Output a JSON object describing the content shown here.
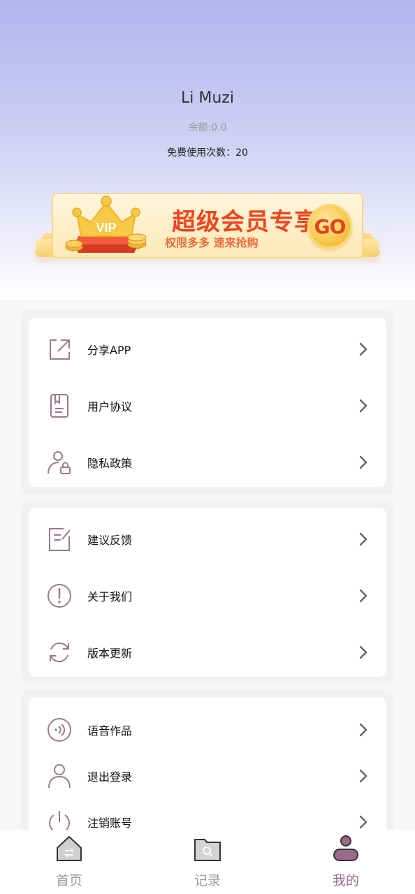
{
  "profile": {
    "username": "Li Muzi",
    "balance_text": "余额:0.0",
    "free_uses_text": "免费使用次数：20"
  },
  "vip_banner": {
    "crown_text": "VIP",
    "title": "超级会员专享",
    "subtitle": "权限多多 速来抢购",
    "go_label": "GO"
  },
  "menu_groups": [
    {
      "items": [
        {
          "label": "分享APP",
          "icon": "share-icon"
        },
        {
          "label": "用户协议",
          "icon": "document-bookmark-icon"
        },
        {
          "label": "隐私政策",
          "icon": "user-lock-icon"
        }
      ]
    },
    {
      "items": [
        {
          "label": "建议反馈",
          "icon": "edit-note-icon"
        },
        {
          "label": "关于我们",
          "icon": "exclamation-circle-icon"
        },
        {
          "label": "版本更新",
          "icon": "refresh-icon"
        }
      ]
    },
    {
      "items": [
        {
          "label": "语音作品",
          "icon": "audio-wave-icon"
        },
        {
          "label": "退出登录",
          "icon": "user-icon"
        },
        {
          "label": "注销账号",
          "icon": "power-icon"
        }
      ]
    }
  ],
  "bottom_nav": [
    {
      "label": "首页",
      "icon": "home-icon",
      "active": false
    },
    {
      "label": "记录",
      "icon": "folder-search-icon",
      "active": false
    },
    {
      "label": "我的",
      "icon": "profile-icon",
      "active": true
    }
  ],
  "colors": {
    "accent": "#9b6a8c",
    "icon_stroke": "#9a7a8e",
    "vip_red": "#f0431f",
    "header_top": "#b4b4ef"
  }
}
